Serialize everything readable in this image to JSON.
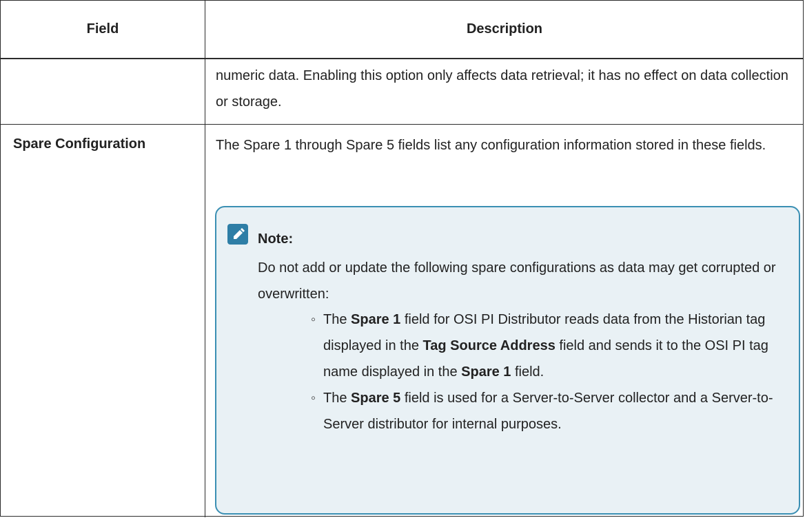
{
  "table": {
    "headers": {
      "field": "Field",
      "description": "Description"
    },
    "row1": {
      "description": "numeric data. Enabling this option only affects data retrieval; it has no effect on data collection or storage."
    },
    "row2": {
      "field": "Spare Configuration",
      "description": "The Spare 1 through Spare 5 fields list any configuration information stored in these fields."
    }
  },
  "note": {
    "icon": "pencil-icon",
    "title": "Note:",
    "text": "Do not add or update the following spare configurations as data may get corrupted or overwritten:",
    "bullet1": {
      "t1": "The ",
      "b1": "Spare 1",
      "t2": " field for OSI PI Distributor reads data from the Historian tag displayed in the ",
      "b2": "Tag Source Address",
      "t3": " field and sends it to the OSI PI tag name displayed in the ",
      "b3": "Spare 1",
      "t4": " field."
    },
    "bullet2": {
      "t1": "The ",
      "b1": "Spare 5",
      "t2": " field is used for a Server-to-Server collector and a Server-to-Server distributor for internal purposes."
    }
  },
  "colors": {
    "note_bg": "#e9f1f5",
    "note_border": "#3a8fb3",
    "icon_bg": "#2e7ea6"
  }
}
